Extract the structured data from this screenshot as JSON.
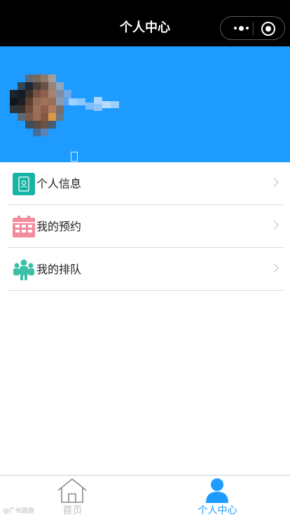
{
  "navbar": {
    "title": "个人中心",
    "menu_icon": "more-dots-icon",
    "close_icon": "target-close-icon"
  },
  "profile": {
    "avatar": "avatar-pixelated",
    "username": "",
    "background_color": "#1e9bff"
  },
  "menu": {
    "items": [
      {
        "label": "个人信息",
        "icon": "id-card-icon",
        "icon_color": "#17b3a3"
      },
      {
        "label": "我的预约",
        "icon": "calendar-icon",
        "icon_color": "#f28b9b"
      },
      {
        "label": "我的排队",
        "icon": "people-group-icon",
        "icon_color": "#3cc0a8"
      }
    ]
  },
  "tabbar": {
    "tabs": [
      {
        "label": "首页",
        "icon": "home-icon",
        "active": false
      },
      {
        "label": "个人中心",
        "icon": "user-icon",
        "active": true
      }
    ],
    "active_color": "#1e9bff",
    "inactive_color": "#c0c0c0",
    "watermark": "@广州跑跑"
  }
}
